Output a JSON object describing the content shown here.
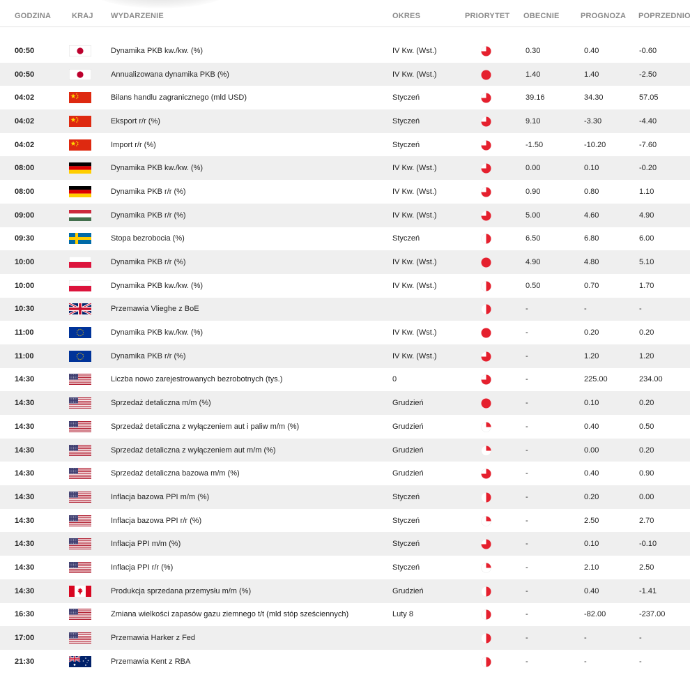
{
  "header": {
    "time": "GODZINA",
    "country": "KRAJ",
    "event": "WYDARZENIE",
    "period": "OKRES",
    "priority": "PRIORYTET",
    "current": "OBECNIE",
    "forecast": "PROGNOZA",
    "previous": "POPRZEDNIO"
  },
  "colors": {
    "priority_red": "#e5202e",
    "row_alt": "#efefef"
  },
  "rows": [
    {
      "time": "00:50",
      "flag": "japan-flag-icon",
      "country": "jp",
      "event": "Dynamika PKB kw./kw. (%)",
      "period": "IV Kw. (Wst.)",
      "priority": 0.75,
      "current": "0.30",
      "forecast": "0.40",
      "previous": "-0.60"
    },
    {
      "time": "00:50",
      "flag": "japan-flag-icon",
      "country": "jp",
      "event": "Annualizowana dynamika PKB (%)",
      "period": "IV Kw. (Wst.)",
      "priority": 1,
      "current": "1.40",
      "forecast": "1.40",
      "previous": "-2.50"
    },
    {
      "time": "04:02",
      "flag": "china-flag-icon",
      "country": "cn",
      "event": "Bilans handlu zagranicznego (mld USD)",
      "period": "Styczeń",
      "priority": 0.75,
      "current": "39.16",
      "forecast": "34.30",
      "previous": "57.05"
    },
    {
      "time": "04:02",
      "flag": "china-flag-icon",
      "country": "cn",
      "event": "Eksport r/r (%)",
      "period": "Styczeń",
      "priority": 0.75,
      "current": "9.10",
      "forecast": "-3.30",
      "previous": "-4.40"
    },
    {
      "time": "04:02",
      "flag": "china-flag-icon",
      "country": "cn",
      "event": "Import r/r (%)",
      "period": "Styczeń",
      "priority": 0.75,
      "current": "-1.50",
      "forecast": "-10.20",
      "previous": "-7.60"
    },
    {
      "time": "08:00",
      "flag": "germany-flag-icon",
      "country": "de",
      "event": "Dynamika PKB kw./kw. (%)",
      "period": "IV Kw. (Wst.)",
      "priority": 0.75,
      "current": "0.00",
      "forecast": "0.10",
      "previous": "-0.20"
    },
    {
      "time": "08:00",
      "flag": "germany-flag-icon",
      "country": "de",
      "event": "Dynamika PKB r/r (%)",
      "period": "IV Kw. (Wst.)",
      "priority": 0.75,
      "current": "0.90",
      "forecast": "0.80",
      "previous": "1.10"
    },
    {
      "time": "09:00",
      "flag": "hungary-flag-icon",
      "country": "hu",
      "event": "Dynamika PKB r/r (%)",
      "period": "IV Kw. (Wst.)",
      "priority": 0.75,
      "current": "5.00",
      "forecast": "4.60",
      "previous": "4.90"
    },
    {
      "time": "09:30",
      "flag": "sweden-flag-icon",
      "country": "se",
      "event": "Stopa bezrobocia (%)",
      "period": "Styczeń",
      "priority": 0.5,
      "current": "6.50",
      "forecast": "6.80",
      "previous": "6.00"
    },
    {
      "time": "10:00",
      "flag": "poland-flag-icon",
      "country": "pl",
      "event": "Dynamika PKB r/r (%)",
      "period": "IV Kw. (Wst.)",
      "priority": 1,
      "current": "4.90",
      "forecast": "4.80",
      "previous": "5.10"
    },
    {
      "time": "10:00",
      "flag": "poland-flag-icon",
      "country": "pl",
      "event": "Dynamika PKB kw./kw. (%)",
      "period": "IV Kw. (Wst.)",
      "priority": 0.5,
      "current": "0.50",
      "forecast": "0.70",
      "previous": "1.70"
    },
    {
      "time": "10:30",
      "flag": "uk-flag-icon",
      "country": "gb",
      "event": "Przemawia Vlieghe z BoE",
      "period": "",
      "priority": 0.5,
      "current": "-",
      "forecast": "-",
      "previous": "-"
    },
    {
      "time": "11:00",
      "flag": "eu-flag-icon",
      "country": "eu",
      "event": "Dynamika PKB kw./kw. (%)",
      "period": "IV Kw. (Wst.)",
      "priority": 1,
      "current": "-",
      "forecast": "0.20",
      "previous": "0.20"
    },
    {
      "time": "11:00",
      "flag": "eu-flag-icon",
      "country": "eu",
      "event": "Dynamika PKB r/r (%)",
      "period": "IV Kw. (Wst.)",
      "priority": 0.75,
      "current": "-",
      "forecast": "1.20",
      "previous": "1.20"
    },
    {
      "time": "14:30",
      "flag": "usa-flag-icon",
      "country": "us",
      "event": "Liczba nowo zarejestrowanych bezrobotnych (tys.)",
      "period": "0",
      "priority": 0.75,
      "current": "-",
      "forecast": "225.00",
      "previous": "234.00"
    },
    {
      "time": "14:30",
      "flag": "usa-flag-icon",
      "country": "us",
      "event": "Sprzedaż detaliczna m/m (%)",
      "period": "Grudzień",
      "priority": 1,
      "current": "-",
      "forecast": "0.10",
      "previous": "0.20"
    },
    {
      "time": "14:30",
      "flag": "usa-flag-icon",
      "country": "us",
      "event": "Sprzedaż detaliczna z wyłączeniem aut i paliw m/m (%)",
      "period": "Grudzień",
      "priority": 0.25,
      "current": "-",
      "forecast": "0.40",
      "previous": "0.50"
    },
    {
      "time": "14:30",
      "flag": "usa-flag-icon",
      "country": "us",
      "event": "Sprzedaż detaliczna z wyłączeniem aut m/m (%)",
      "period": "Grudzień",
      "priority": 0.25,
      "current": "-",
      "forecast": "0.00",
      "previous": "0.20"
    },
    {
      "time": "14:30",
      "flag": "usa-flag-icon",
      "country": "us",
      "event": "Sprzedaż detaliczna bazowa m/m (%)",
      "period": "Grudzień",
      "priority": 0.75,
      "current": "-",
      "forecast": "0.40",
      "previous": "0.90"
    },
    {
      "time": "14:30",
      "flag": "usa-flag-icon",
      "country": "us",
      "event": "Inflacja bazowa PPI m/m (%)",
      "period": "Styczeń",
      "priority": 0.5,
      "current": "-",
      "forecast": "0.20",
      "previous": "0.00"
    },
    {
      "time": "14:30",
      "flag": "usa-flag-icon",
      "country": "us",
      "event": "Inflacja bazowa PPI r/r (%)",
      "period": "Styczeń",
      "priority": 0.25,
      "current": "-",
      "forecast": "2.50",
      "previous": "2.70"
    },
    {
      "time": "14:30",
      "flag": "usa-flag-icon",
      "country": "us",
      "event": "Inflacja PPI m/m (%)",
      "period": "Styczeń",
      "priority": 0.75,
      "current": "-",
      "forecast": "0.10",
      "previous": "-0.10"
    },
    {
      "time": "14:30",
      "flag": "usa-flag-icon",
      "country": "us",
      "event": "Inflacja PPI r/r (%)",
      "period": "Styczeń",
      "priority": 0.25,
      "current": "-",
      "forecast": "2.10",
      "previous": "2.50"
    },
    {
      "time": "14:30",
      "flag": "canada-flag-icon",
      "country": "ca",
      "event": "Produkcja sprzedana przemysłu m/m (%)",
      "period": "Grudzień",
      "priority": 0.5,
      "current": "-",
      "forecast": "0.40",
      "previous": "-1.41"
    },
    {
      "time": "16:30",
      "flag": "usa-flag-icon",
      "country": "us",
      "event": "Zmiana wielkości zapasów gazu ziemnego t/t (mld stóp sześciennych)",
      "period": "Luty 8",
      "priority": 0.5,
      "current": "-",
      "forecast": "-82.00",
      "previous": "-237.00"
    },
    {
      "time": "17:00",
      "flag": "usa-flag-icon",
      "country": "us",
      "event": "Przemawia Harker z Fed",
      "period": "",
      "priority": 0.5,
      "current": "-",
      "forecast": "-",
      "previous": "-"
    },
    {
      "time": "21:30",
      "flag": "australia-flag-icon",
      "country": "au",
      "event": "Przemawia Kent z RBA",
      "period": "",
      "priority": 0.5,
      "current": "-",
      "forecast": "-",
      "previous": "-"
    }
  ]
}
